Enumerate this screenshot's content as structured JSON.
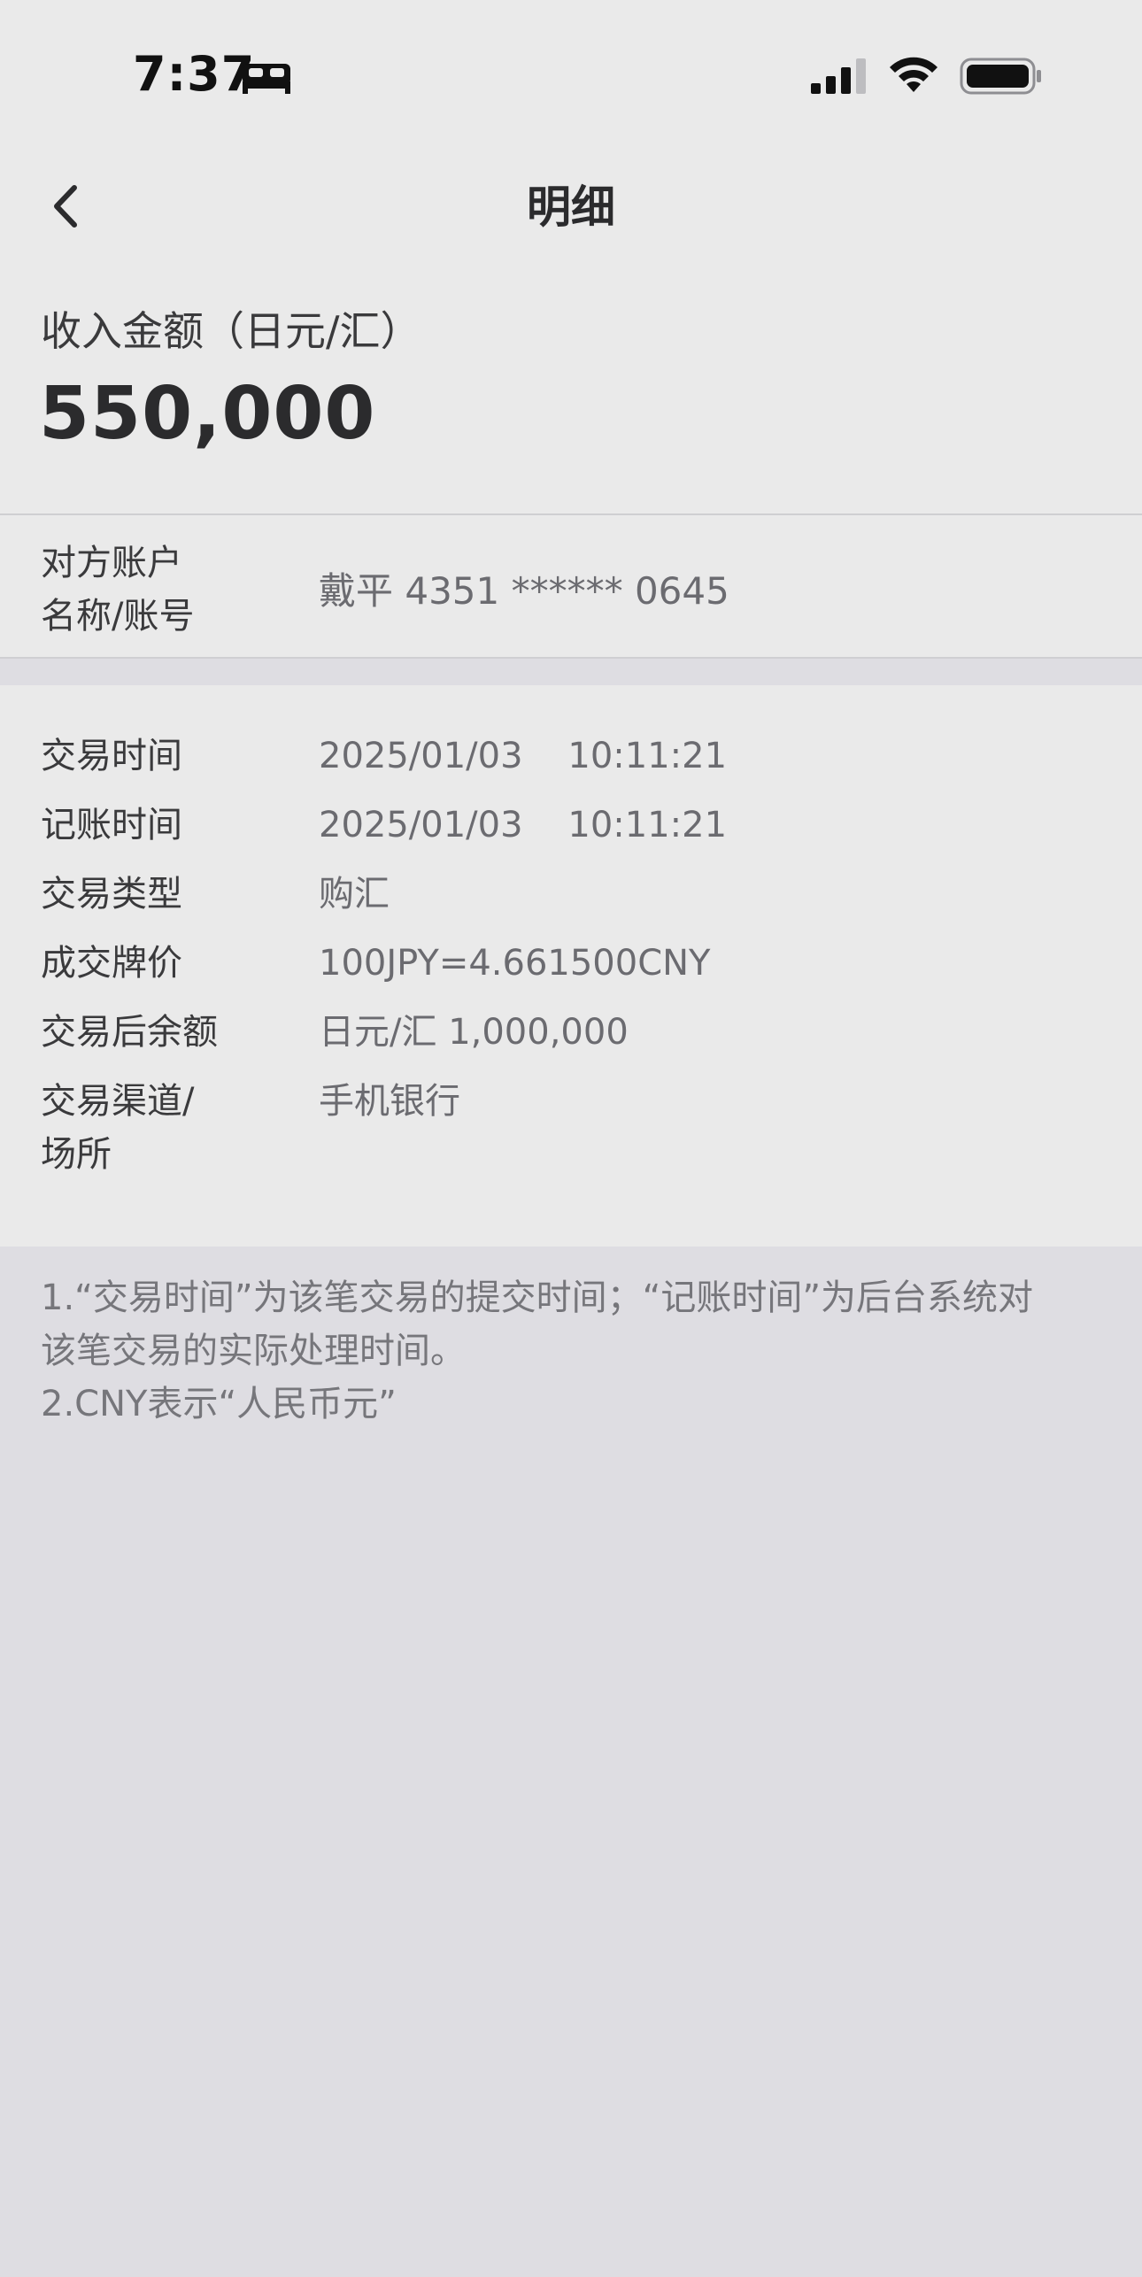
{
  "status_bar": {
    "time": "7:37",
    "icons": [
      "sleep-focus-icon",
      "cellular-signal-icon",
      "wifi-icon",
      "battery-icon"
    ]
  },
  "nav": {
    "title": "明细",
    "back_icon": "chevron-left-icon"
  },
  "amount": {
    "label": "收入金额（日元/汇）",
    "value": "550,000"
  },
  "account": {
    "label_line1": "对方账户",
    "label_line2": "名称/账号",
    "value": "戴平 4351 ****** 0645"
  },
  "details": [
    {
      "label": "交易时间",
      "value": "2025/01/03    10:11:21"
    },
    {
      "label": "记账时间",
      "value": "2025/01/03    10:11:21"
    },
    {
      "label": "交易类型",
      "value": "购汇"
    },
    {
      "label": "成交牌价",
      "value": "100JPY=4.661500CNY"
    },
    {
      "label": "交易后余额",
      "value": "日元/汇 1,000,000"
    },
    {
      "label": "交易渠道/",
      "label_line2": "场所",
      "value": "手机银行"
    }
  ],
  "notes": {
    "line1": "1.“交易时间”为该笔交易的提交时间；“记账时间”为后台系统对",
    "line2": "该笔交易的实际处理时间。",
    "line3": "2.CNY表示“人民币元”"
  },
  "colors": {
    "background": "#dedde2",
    "card": "#eaeaea",
    "primary_text": "#2b2b2d",
    "secondary_text": "#6b6b70"
  }
}
